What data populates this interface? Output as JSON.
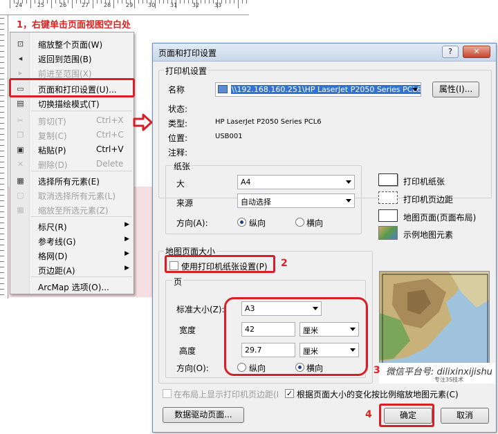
{
  "ruler": {
    "numbers": [
      "24",
      "25",
      "26",
      "27",
      "28",
      "29",
      "30",
      "31",
      "32",
      "33"
    ]
  },
  "annotations": {
    "step1": "1，右键单击页面视图空白处",
    "step2": "2",
    "step3": "3",
    "step4": "4"
  },
  "context_menu": {
    "items": [
      {
        "label": "缩放整个页面(W)",
        "shortcut": "",
        "icon": "zoom-whole-page-icon",
        "glyph": "⊡",
        "enabled": true
      },
      {
        "label": "返回到范围(B)",
        "shortcut": "",
        "icon": "go-back-icon",
        "glyph": "◂",
        "enabled": true
      },
      {
        "label": "前进至范围(X)",
        "shortcut": "",
        "icon": "go-forward-icon",
        "glyph": "▸",
        "enabled": false
      },
      {
        "label": "页面和打印设置(U)...",
        "shortcut": "",
        "icon": "page-setup-icon",
        "glyph": "▭",
        "enabled": true
      },
      {
        "label": "切换描绘模式(T)",
        "shortcut": "",
        "icon": "toggle-draft-icon",
        "glyph": "▤",
        "enabled": true
      },
      {
        "label": "剪切(T)",
        "shortcut": "Ctrl+X",
        "icon": "scissors-icon",
        "glyph": "✂",
        "enabled": false
      },
      {
        "label": "复制(C)",
        "shortcut": "Ctrl+C",
        "icon": "copy-icon",
        "glyph": "❐",
        "enabled": false
      },
      {
        "label": "粘贴(P)",
        "shortcut": "Ctrl+V",
        "icon": "paste-icon",
        "glyph": "▣",
        "enabled": true
      },
      {
        "label": "删除(D)",
        "shortcut": "Delete",
        "icon": "delete-icon",
        "glyph": "✕",
        "enabled": false
      },
      {
        "label": "选择所有元素(E)",
        "shortcut": "",
        "icon": "select-all-icon",
        "glyph": "▦",
        "enabled": true
      },
      {
        "label": "取消选择所有元素(L)",
        "shortcut": "",
        "icon": "unselect-all-icon",
        "glyph": "▢",
        "enabled": false
      },
      {
        "label": "缩放至所选元素(Z)",
        "shortcut": "",
        "icon": "zoom-selected-icon",
        "glyph": "▦",
        "enabled": false
      },
      {
        "label": "标尺(R)",
        "shortcut": "",
        "icon": "",
        "glyph": "",
        "enabled": true,
        "submenu": true
      },
      {
        "label": "参考线(G)",
        "shortcut": "",
        "icon": "",
        "glyph": "",
        "enabled": true,
        "submenu": true
      },
      {
        "label": "格网(D)",
        "shortcut": "",
        "icon": "",
        "glyph": "",
        "enabled": true,
        "submenu": true
      },
      {
        "label": "页边距(A)",
        "shortcut": "",
        "icon": "",
        "glyph": "",
        "enabled": true,
        "submenu": true
      },
      {
        "label": "ArcMap 选项(O)...",
        "shortcut": "",
        "icon": "",
        "glyph": "",
        "enabled": true
      }
    ]
  },
  "dialog": {
    "title": "页面和打印设置",
    "help_label": "?",
    "close_label": "✕",
    "printer": {
      "group_label": "打印机设置",
      "name_label": "名称",
      "name_value": "\\\\192.168.160.251\\HP LaserJet P2050 Series PCL6",
      "properties_label": "属性(I)...",
      "status_label": "状态:",
      "type_label": "类型:",
      "type_value": "HP LaserJet P2050 Series PCL6",
      "where_label": "位置:",
      "where_value": "USB001",
      "comment_label": "注释:"
    },
    "paper": {
      "group_label": "纸张",
      "size_label": "大",
      "size_value": "A4",
      "source_label": "来源",
      "source_value": "自动选择",
      "orientation_label": "方向(A):",
      "portrait_label": "纵向",
      "landscape_label": "横向",
      "orientation_selected": "portrait"
    },
    "legend": {
      "printer_paper": "打印机纸张",
      "printer_margins": "打印机页边距",
      "map_page": "地图页面(页面布局)",
      "sample_elements": "示例地图元素"
    },
    "map_page": {
      "group_label": "地图页面大小",
      "use_printer_label": "使用打印机纸张设置(P)",
      "use_printer_checked": false,
      "page_label": "页",
      "standard_label": "标准大小(Z):",
      "standard_value": "A3",
      "width_label": "宽度",
      "width_value": "42",
      "width_unit": "厘米",
      "height_label": "高度",
      "height_value": "29.7",
      "height_unit": "厘米",
      "orientation_label": "方向(O):",
      "portrait_label": "纵向",
      "landscape_label": "横向",
      "orientation_selected": "landscape"
    },
    "show_margins_label": "在布局上显示打印机页边距(I",
    "show_margins_checked": false,
    "scale_elements_label": "根据页面大小的变化按比例缩放地图元素(C)",
    "scale_elements_checked": true,
    "data_driven_label": "数据驱动页面...",
    "ok_label": "确定",
    "cancel_label": "取消"
  },
  "watermark": {
    "text": "微信平台号: dilixinxijishu",
    "sub": "专注3S技术"
  }
}
